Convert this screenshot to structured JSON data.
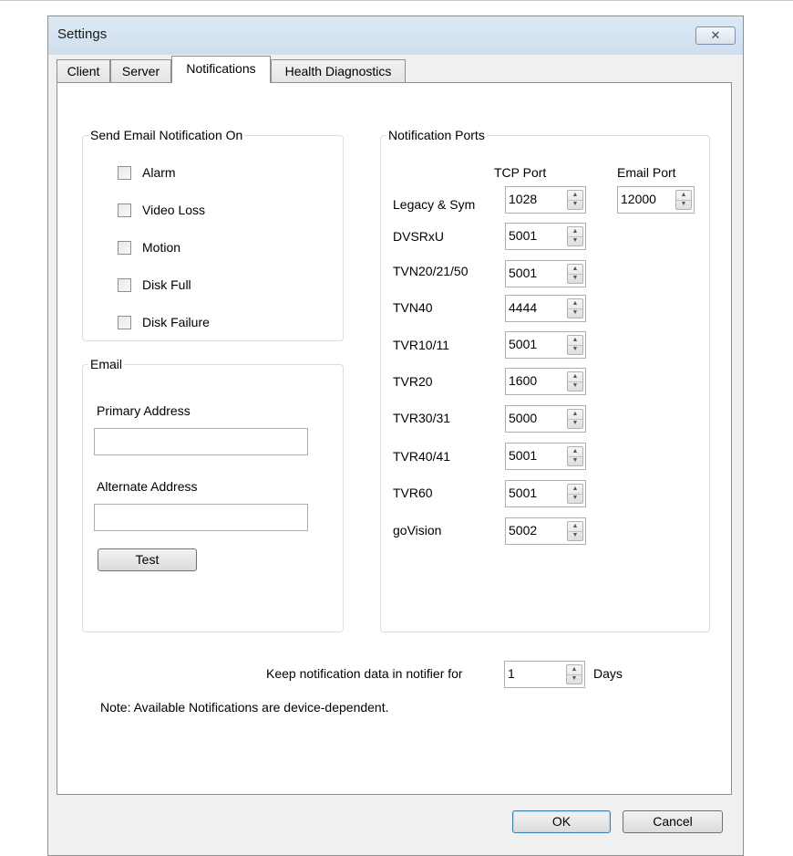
{
  "window": {
    "title": "Settings",
    "close_glyph": "✕"
  },
  "tabs": [
    {
      "label": "Client",
      "active": false
    },
    {
      "label": "Server",
      "active": false
    },
    {
      "label": "Notifications",
      "active": true
    },
    {
      "label": "Health Diagnostics",
      "active": false
    }
  ],
  "send_email": {
    "legend": "Send Email Notification On",
    "items": [
      {
        "label": "Alarm",
        "checked": false
      },
      {
        "label": "Video Loss",
        "checked": false
      },
      {
        "label": "Motion",
        "checked": false
      },
      {
        "label": "Disk Full",
        "checked": false
      },
      {
        "label": "Disk Failure",
        "checked": false
      }
    ]
  },
  "email": {
    "legend": "Email",
    "primary_label": "Primary Address",
    "primary_value": "",
    "alternate_label": "Alternate Address",
    "alternate_value": "",
    "test_label": "Test"
  },
  "ports": {
    "legend": "Notification Ports",
    "tcp_header": "TCP Port",
    "email_header": "Email Port",
    "rows": [
      {
        "label": "Legacy & Sym",
        "tcp": "1028",
        "email": "12000"
      },
      {
        "label": "DVSRxU",
        "tcp": "5001"
      },
      {
        "label": "TVN20/21/50",
        "tcp": "5001"
      },
      {
        "label": "TVN40",
        "tcp": "4444"
      },
      {
        "label": "TVR10/11",
        "tcp": "5001"
      },
      {
        "label": "TVR20",
        "tcp": "1600"
      },
      {
        "label": "TVR30/31",
        "tcp": "5000"
      },
      {
        "label": "TVR40/41",
        "tcp": "5001"
      },
      {
        "label": "TVR60",
        "tcp": "5001"
      },
      {
        "label": "goVision",
        "tcp": "5002"
      }
    ]
  },
  "keep": {
    "prefix": "Keep notification data in notifier for",
    "value": "1",
    "suffix": "Days"
  },
  "note": "Note:  Available Notifications are device-dependent.",
  "footer": {
    "ok_label": "OK",
    "cancel_label": "Cancel"
  }
}
